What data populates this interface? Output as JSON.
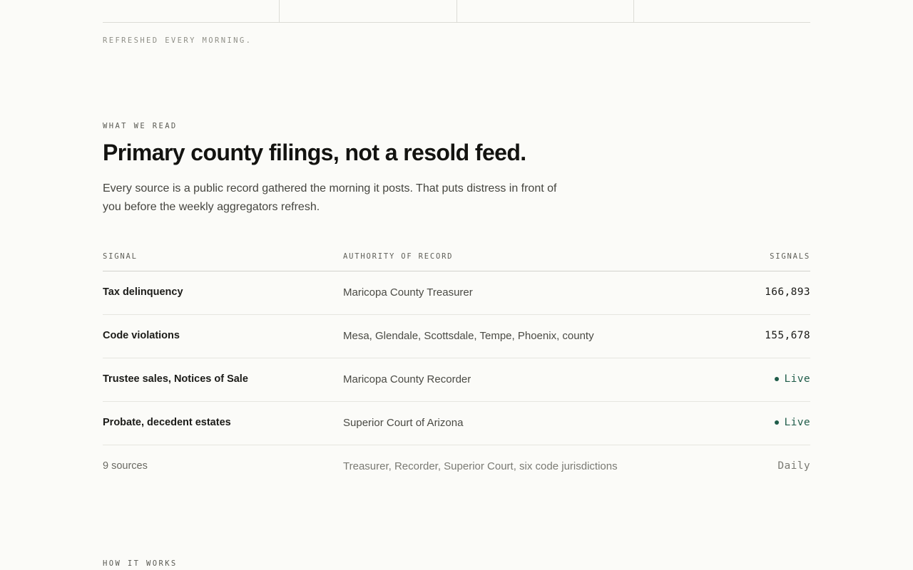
{
  "top_note": "REFRESHED EVERY MORNING.",
  "section": {
    "eyebrow": "WHAT WE READ",
    "title": "Primary county filings, not a resold feed.",
    "lede": "Every source is a public record gathered the morning it posts. That puts distress in front of you before the weekly aggregators refresh."
  },
  "table": {
    "headers": {
      "signal": "SIGNAL",
      "authority": "AUTHORITY OF RECORD",
      "signals": "SIGNALS"
    },
    "rows": [
      {
        "signal": "Tax delinquency",
        "authority": "Maricopa County Treasurer",
        "value": "166,893"
      },
      {
        "signal": "Code violations",
        "authority": "Mesa, Glendale, Scottsdale, Tempe, Phoenix, county",
        "value": "155,678"
      },
      {
        "signal": "Trustee sales, Notices of Sale",
        "authority": "Maricopa County Recorder",
        "value": "Live"
      },
      {
        "signal": "Probate, decedent estates",
        "authority": "Superior Court of Arizona",
        "value": "Live"
      }
    ],
    "summary": {
      "signal": "9 sources",
      "authority": "Treasurer, Recorder, Superior Court, six code jurisdictions",
      "value": "Daily"
    }
  },
  "next_section": {
    "eyebrow": "HOW IT WORKS"
  },
  "colors": {
    "background": "#fbfbf8",
    "live_accent": "#1f5c49",
    "text": "#1b1b18"
  }
}
